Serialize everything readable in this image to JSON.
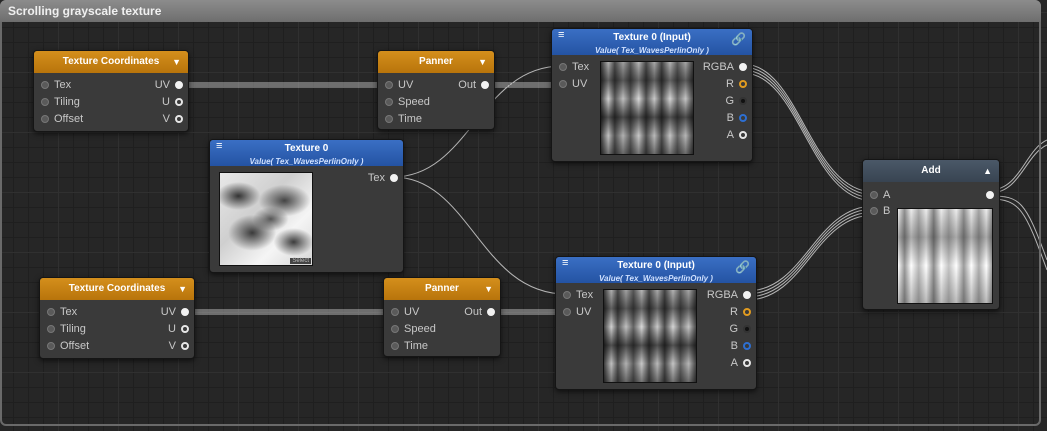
{
  "group": {
    "title": "Scrolling grayscale texture"
  },
  "nodes": {
    "tc1": {
      "title": "Texture Coordinates",
      "inputs": [
        "Tex",
        "Tiling",
        "Offset"
      ],
      "outputs": [
        "UV",
        "U",
        "V"
      ]
    },
    "panner1": {
      "title": "Panner",
      "inputs": [
        "UV",
        "Speed",
        "Time"
      ],
      "outputs": [
        "Out"
      ]
    },
    "tex_in1": {
      "title": "Texture 0 (Input)",
      "subtitle": "Value( Tex_WavesPerlinOnly )",
      "inputs": [
        "Tex",
        "UV"
      ],
      "outputs": [
        "RGBA",
        "R",
        "G",
        "B",
        "A"
      ]
    },
    "tex0": {
      "title": "Texture 0",
      "subtitle": "Value( Tex_WavesPerlinOnly )",
      "outputs": [
        "Tex"
      ],
      "select_label": "Select"
    },
    "tc2": {
      "title": "Texture Coordinates",
      "inputs": [
        "Tex",
        "Tiling",
        "Offset"
      ],
      "outputs": [
        "UV",
        "U",
        "V"
      ]
    },
    "panner2": {
      "title": "Panner",
      "inputs": [
        "UV",
        "Speed",
        "Time"
      ],
      "outputs": [
        "Out"
      ]
    },
    "tex_in2": {
      "title": "Texture 0 (Input)",
      "subtitle": "Value( Tex_WavesPerlinOnly )",
      "inputs": [
        "Tex",
        "UV"
      ],
      "outputs": [
        "RGBA",
        "R",
        "G",
        "B",
        "A"
      ]
    },
    "add": {
      "title": "Add",
      "inputs": [
        "A",
        "B"
      ]
    }
  },
  "icons": {
    "menu": "hamburger-icon",
    "link": "chain-link-icon",
    "collapse": "triangle-down-icon",
    "expand": "triangle-up-icon"
  }
}
